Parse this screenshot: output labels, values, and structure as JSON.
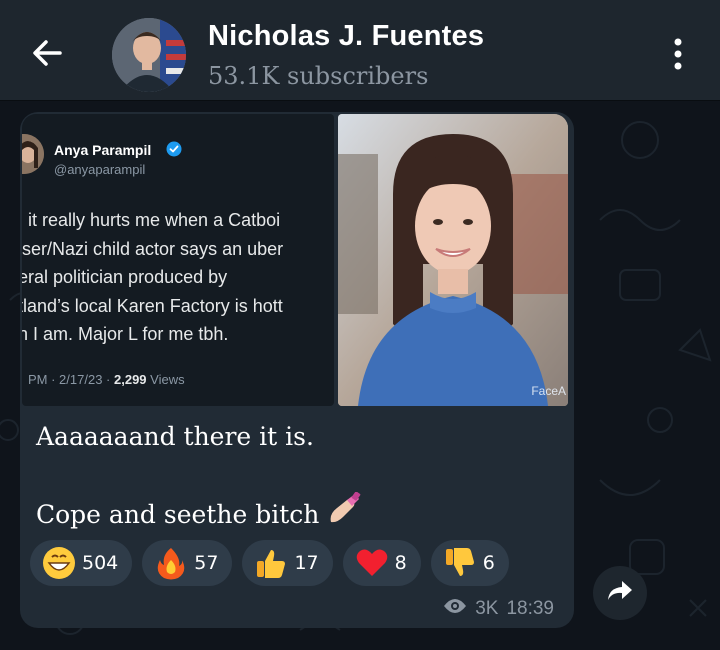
{
  "header": {
    "title": "Nicholas J. Fuentes",
    "subtitle": "53.1K subscribers"
  },
  "post": {
    "tweet": {
      "author_name": "Anya Parampil",
      "author_handle": "@anyaparampil",
      "lines": [
        ", it really hurts me when a Catboi",
        "iser/Nazi child actor says an uber",
        "eral politician produced by",
        "tland’s local Karen Factory is hott",
        "n I am. Major L for me tbh."
      ],
      "time_date": "PM · 2/17/23 ·",
      "views_count": "2,299",
      "views_label": "Views"
    },
    "photo_watermark": "FaceA",
    "caption_line1": "Aaaaaaand there it is.",
    "caption_line2": "Cope and seethe bitch",
    "reactions": [
      {
        "emoji": "grinning-face",
        "count": "504"
      },
      {
        "emoji": "fire",
        "count": "57"
      },
      {
        "emoji": "thumbs-up",
        "count": "17"
      },
      {
        "emoji": "red-heart",
        "count": "8"
      },
      {
        "emoji": "thumbs-down",
        "count": "6"
      }
    ],
    "views": "3K",
    "time": "18:39"
  },
  "colors": {
    "header_bg": "#1e262e",
    "bubble_bg": "#212b35",
    "reaction_bg": "#2f3c49",
    "accent_blue": "#1d9bf0"
  }
}
